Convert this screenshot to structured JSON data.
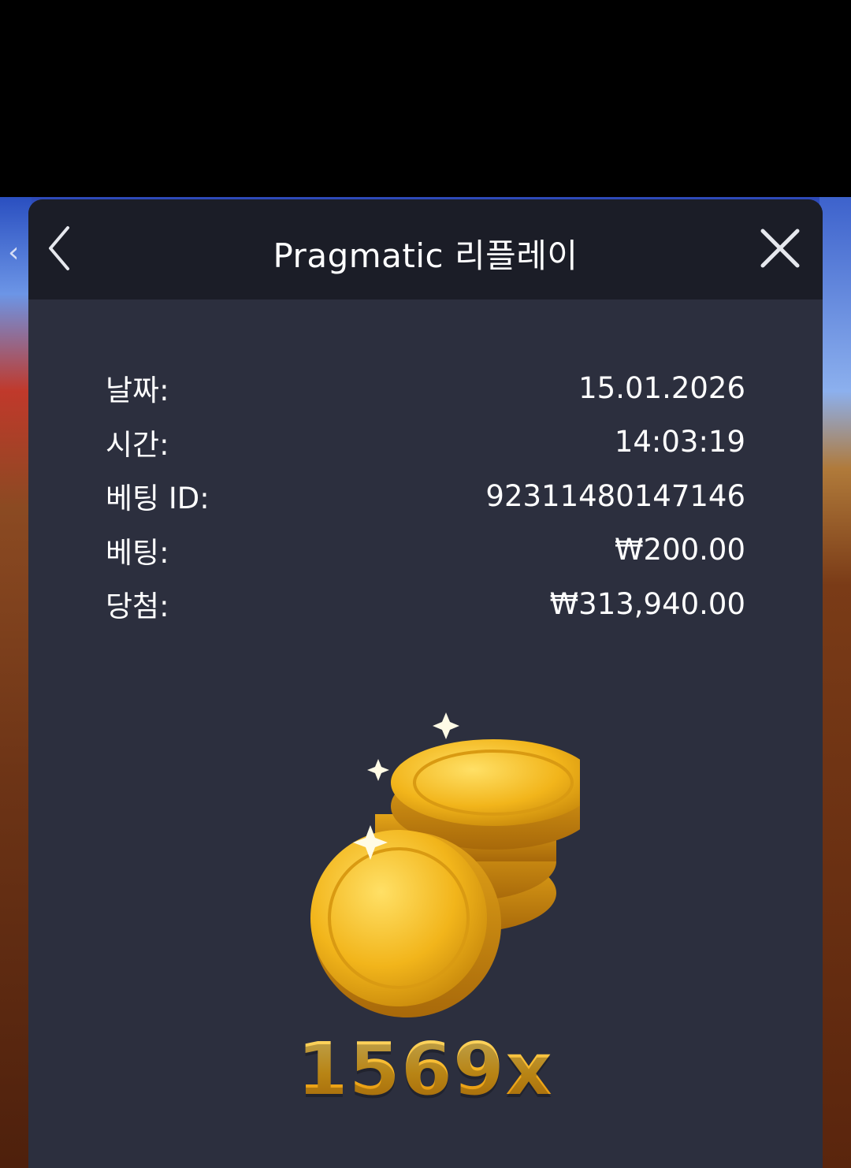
{
  "modal": {
    "title": "Pragmatic 리플레이"
  },
  "details": [
    {
      "label": "날짜:",
      "value": "15.01.2026"
    },
    {
      "label": "시간:",
      "value": "14:03:19"
    },
    {
      "label": "베팅 ID:",
      "value": "92311480147146"
    },
    {
      "label": "베팅:",
      "value": "₩200.00"
    },
    {
      "label": "당첨:",
      "value": "₩313,940.00"
    }
  ],
  "win": {
    "multiplier": "1569x"
  },
  "icons": {
    "back": "chevron-left-icon",
    "close": "close-icon",
    "coins": "gold-coins-icon"
  },
  "colors": {
    "modal_bg": "#2c2f3e",
    "header_bg": "#1b1d27",
    "multiplier": "#f4b21f"
  }
}
